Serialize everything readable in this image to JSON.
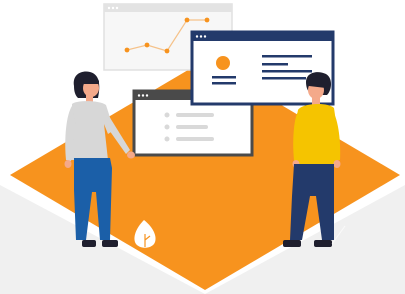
{
  "illustration": {
    "palette": {
      "background": "#ffffff",
      "floor": "#f0f0f0",
      "diamond": "#f7931e",
      "navy": "#233a6b",
      "dark_window": "#4a4a4a",
      "orange": "#f7931e",
      "yellow_shirt": "#f5c400",
      "blue_jeans": "#1b5fa8",
      "grey_shirt": "#d7d7d7",
      "skin": "#f4a98a",
      "hair": "#1f1f2e",
      "light_grey": "#cfcfcf",
      "pale_grey": "#e6e6e6"
    },
    "chart_points": [
      0.3,
      0.45,
      0.4,
      0.9,
      0.85
    ],
    "icons": {
      "left_person": "woman-figure-icon",
      "right_person": "man-figure-icon",
      "plant": "leaf-plant-icon",
      "chart_window": "line-chart-window-icon",
      "list_window": "list-window-icon",
      "profile_window": "profile-card-window-icon"
    }
  }
}
